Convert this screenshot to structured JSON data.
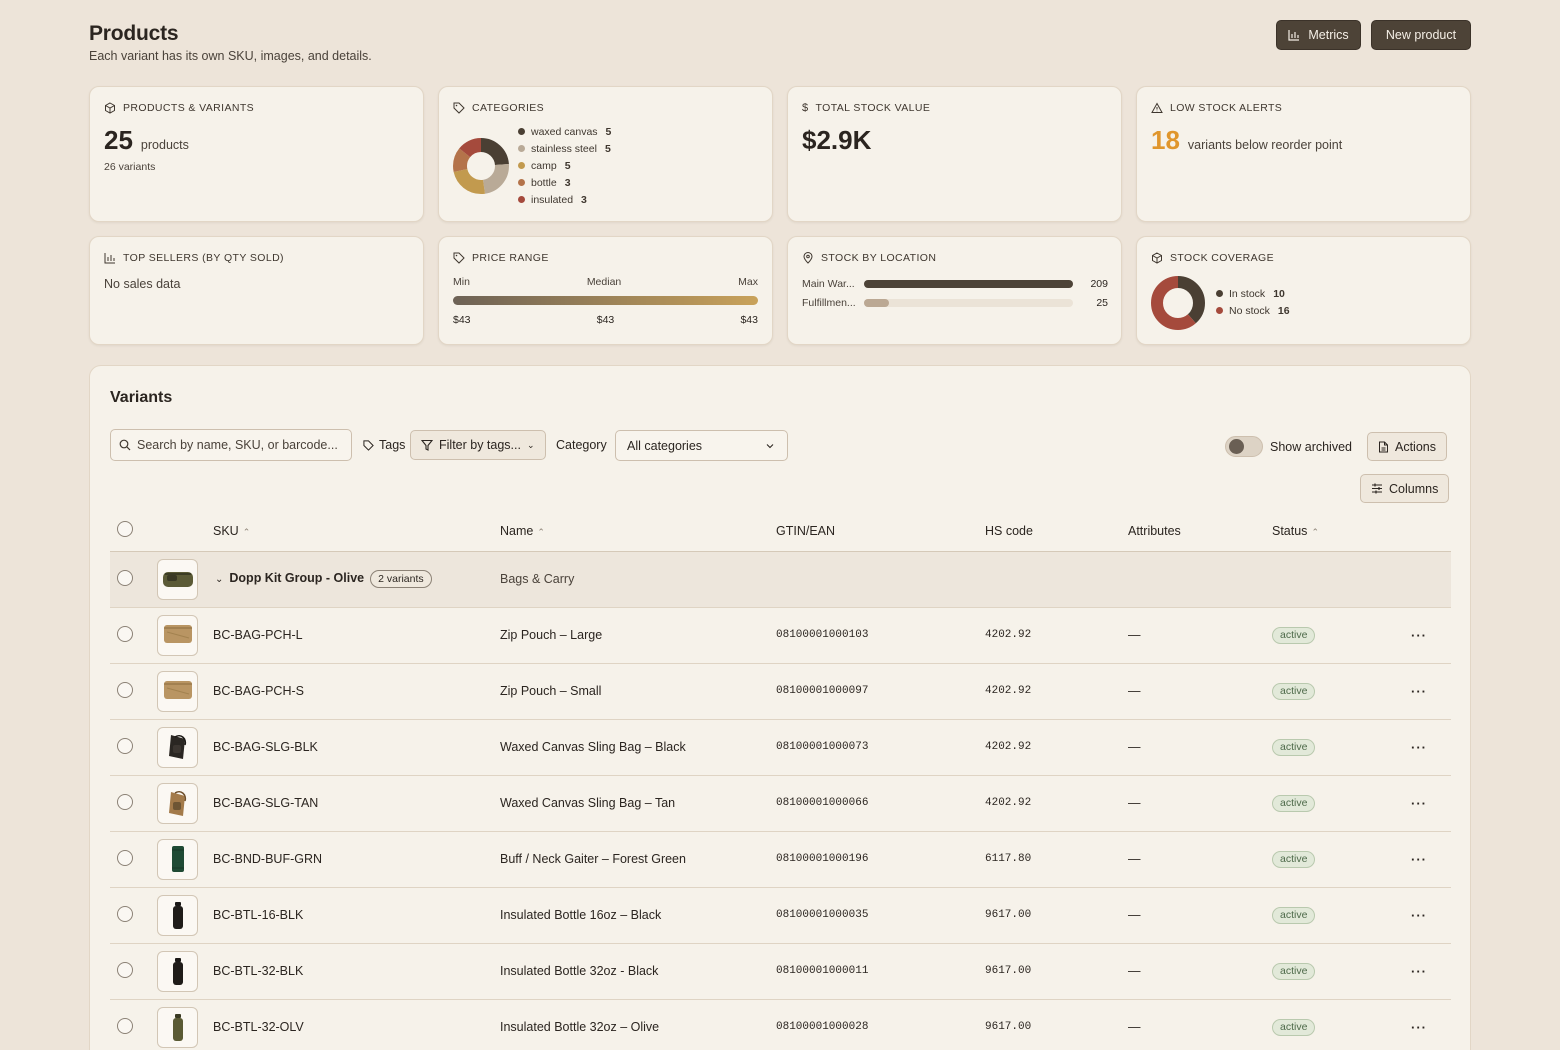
{
  "header": {
    "title": "Products",
    "subtitle": "Each variant has its own SKU, images, and details.",
    "metrics_label": "Metrics",
    "new_label": "New product"
  },
  "cards": {
    "products": {
      "label": "PRODUCTS & VARIANTS",
      "count": "25",
      "unit": "products",
      "variants": "26 variants"
    },
    "categories": {
      "label": "CATEGORIES",
      "items": [
        {
          "name": "waxed canvas",
          "count": "5",
          "color": "#4a3f33"
        },
        {
          "name": "stainless steel",
          "count": "5",
          "color": "#b9aa97"
        },
        {
          "name": "camp",
          "count": "5",
          "color": "#c29a4e"
        },
        {
          "name": "bottle",
          "count": "3",
          "color": "#b4734a"
        },
        {
          "name": "insulated",
          "count": "3",
          "color": "#a54a3c"
        }
      ]
    },
    "stock_value": {
      "label": "TOTAL STOCK VALUE",
      "value": "$2.9K"
    },
    "low_stock": {
      "label": "LOW STOCK ALERTS",
      "count": "18",
      "text": "variants below reorder point",
      "color": "#e0962c"
    },
    "top_sellers": {
      "label": "TOP SELLERS (BY QTY SOLD)",
      "empty": "No sales data"
    },
    "price_range": {
      "label": "PRICE RANGE",
      "min_label": "Min",
      "median_label": "Median",
      "max_label": "Max",
      "min": "$43",
      "median": "$43",
      "max": "$43"
    },
    "stock_location": {
      "label": "STOCK BY LOCATION",
      "rows": [
        {
          "name": "Main War...",
          "qty": "209",
          "value": 209,
          "color": "#4d4337"
        },
        {
          "name": "Fulfillmen...",
          "qty": "25",
          "value": 25,
          "color": "#bba893"
        }
      ],
      "max": 209
    },
    "coverage": {
      "label": "STOCK COVERAGE",
      "items": [
        {
          "name": "In stock",
          "count": "10",
          "value": 10,
          "color": "#4a3f33"
        },
        {
          "name": "No stock",
          "count": "16",
          "value": 16,
          "color": "#a54a3c"
        }
      ]
    }
  },
  "variants": {
    "title": "Variants",
    "search_placeholder": "Search by name, SKU, or barcode...",
    "tags_label": "Tags",
    "filter_tags": "Filter by tags...",
    "category_label": "Category",
    "category_value": "All categories",
    "show_archived": "Show archived",
    "actions_label": "Actions",
    "columns_label": "Columns",
    "headers": {
      "sku": "SKU",
      "name": "Name",
      "gtin": "GTIN/EAN",
      "hs": "HS code",
      "attributes": "Attributes",
      "status": "Status"
    },
    "group": {
      "name": "Dopp Kit Group - Olive",
      "variants": "2 variants",
      "category": "Bags & Carry"
    },
    "rows": [
      {
        "sku": "BC-BAG-PCH-L",
        "name": "Zip Pouch – Large",
        "gtin": "08100001000103",
        "hs": "4202.92",
        "attr": "—",
        "status": "active",
        "thumb": "pouch"
      },
      {
        "sku": "BC-BAG-PCH-S",
        "name": "Zip Pouch – Small",
        "gtin": "08100001000097",
        "hs": "4202.92",
        "attr": "—",
        "status": "active",
        "thumb": "pouch"
      },
      {
        "sku": "BC-BAG-SLG-BLK",
        "name": "Waxed Canvas Sling Bag – Black",
        "gtin": "08100001000073",
        "hs": "4202.92",
        "attr": "—",
        "status": "active",
        "thumb": "sling-black"
      },
      {
        "sku": "BC-BAG-SLG-TAN",
        "name": "Waxed Canvas Sling Bag – Tan",
        "gtin": "08100001000066",
        "hs": "4202.92",
        "attr": "—",
        "status": "active",
        "thumb": "sling-tan"
      },
      {
        "sku": "BC-BND-BUF-GRN",
        "name": "Buff / Neck Gaiter – Forest Green",
        "gtin": "08100001000196",
        "hs": "6117.80",
        "attr": "—",
        "status": "active",
        "thumb": "buff"
      },
      {
        "sku": "BC-BTL-16-BLK",
        "name": "Insulated Bottle 16oz – Black",
        "gtin": "08100001000035",
        "hs": "9617.00",
        "attr": "—",
        "status": "active",
        "thumb": "bottle-black"
      },
      {
        "sku": "BC-BTL-32-BLK",
        "name": "Insulated Bottle 32oz - Black",
        "gtin": "08100001000011",
        "hs": "9617.00",
        "attr": "—",
        "status": "active",
        "thumb": "bottle-black"
      },
      {
        "sku": "BC-BTL-32-OLV",
        "name": "Insulated Bottle 32oz – Olive",
        "gtin": "08100001000028",
        "hs": "9617.00",
        "attr": "—",
        "status": "active",
        "thumb": "bottle-olive"
      }
    ]
  }
}
